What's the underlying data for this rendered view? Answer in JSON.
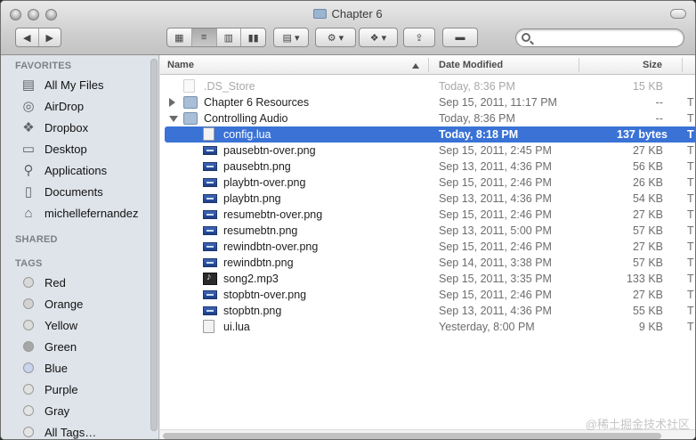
{
  "window": {
    "title": "Chapter 6"
  },
  "toolbar": {
    "view_icon": "icon-view-grid",
    "list_icon": "list-view-icon",
    "column_icon": "column-view-icon",
    "coverflow_icon": "coverflow-icon"
  },
  "sidebar": {
    "favorites_header": "FAVORITES",
    "favorites": [
      {
        "label": "All My Files",
        "icon": "all-files-icon"
      },
      {
        "label": "AirDrop",
        "icon": "airdrop-icon"
      },
      {
        "label": "Dropbox",
        "icon": "dropbox-icon"
      },
      {
        "label": "Desktop",
        "icon": "desktop-icon"
      },
      {
        "label": "Applications",
        "icon": "applications-icon"
      },
      {
        "label": "Documents",
        "icon": "documents-icon"
      },
      {
        "label": "michellefernandez",
        "icon": "home-icon"
      }
    ],
    "shared_header": "SHARED",
    "tags_header": "TAGS",
    "tags": [
      {
        "label": "Red",
        "color": "#d9d9d9"
      },
      {
        "label": "Orange",
        "color": "#d2d2d2"
      },
      {
        "label": "Yellow",
        "color": "#dcdcdc"
      },
      {
        "label": "Green",
        "color": "#a6a6a6"
      },
      {
        "label": "Blue",
        "color": "#c9d4ee"
      },
      {
        "label": "Purple",
        "color": "#e2e2e2"
      },
      {
        "label": "Gray",
        "color": "#e5e5e5"
      },
      {
        "label": "All Tags…",
        "color": "#e5e5e5"
      }
    ]
  },
  "list": {
    "columns": {
      "name": "Name",
      "date": "Date Modified",
      "size": "Size"
    },
    "rows": [
      {
        "name": ".DS_Store",
        "date": "Today, 8:36 PM",
        "size": "15 KB",
        "kind": "",
        "icon": "doc",
        "indent": 1,
        "disclosure": "none",
        "dim": true,
        "selected": false
      },
      {
        "name": "Chapter 6 Resources",
        "date": "Sep 15, 2011, 11:17 PM",
        "size": "--",
        "kind": "",
        "icon": "folder",
        "indent": 1,
        "disclosure": "closed",
        "dim": false,
        "selected": false
      },
      {
        "name": "Controlling Audio",
        "date": "Today, 8:36 PM",
        "size": "--",
        "kind": "",
        "icon": "folder",
        "indent": 1,
        "disclosure": "open",
        "dim": false,
        "selected": false
      },
      {
        "name": "config.lua",
        "date": "Today, 8:18 PM",
        "size": "137 bytes",
        "kind": "T",
        "icon": "doc",
        "indent": 2,
        "disclosure": "none",
        "dim": false,
        "selected": true
      },
      {
        "name": "pausebtn-over.png",
        "date": "Sep 15, 2011, 2:45 PM",
        "size": "27 KB",
        "kind": "",
        "icon": "png",
        "indent": 2,
        "disclosure": "none",
        "dim": false,
        "selected": false
      },
      {
        "name": "pausebtn.png",
        "date": "Sep 13, 2011, 4:36 PM",
        "size": "56 KB",
        "kind": "",
        "icon": "png",
        "indent": 2,
        "disclosure": "none",
        "dim": false,
        "selected": false
      },
      {
        "name": "playbtn-over.png",
        "date": "Sep 15, 2011, 2:46 PM",
        "size": "26 KB",
        "kind": "",
        "icon": "png",
        "indent": 2,
        "disclosure": "none",
        "dim": false,
        "selected": false
      },
      {
        "name": "playbtn.png",
        "date": "Sep 13, 2011, 4:36 PM",
        "size": "54 KB",
        "kind": "",
        "icon": "png",
        "indent": 2,
        "disclosure": "none",
        "dim": false,
        "selected": false
      },
      {
        "name": "resumebtn-over.png",
        "date": "Sep 15, 2011, 2:46 PM",
        "size": "27 KB",
        "kind": "",
        "icon": "png",
        "indent": 2,
        "disclosure": "none",
        "dim": false,
        "selected": false
      },
      {
        "name": "resumebtn.png",
        "date": "Sep 13, 2011, 5:00 PM",
        "size": "57 KB",
        "kind": "",
        "icon": "png",
        "indent": 2,
        "disclosure": "none",
        "dim": false,
        "selected": false
      },
      {
        "name": "rewindbtn-over.png",
        "date": "Sep 15, 2011, 2:46 PM",
        "size": "27 KB",
        "kind": "",
        "icon": "png",
        "indent": 2,
        "disclosure": "none",
        "dim": false,
        "selected": false
      },
      {
        "name": "rewindbtn.png",
        "date": "Sep 14, 2011, 3:38 PM",
        "size": "57 KB",
        "kind": "",
        "icon": "png",
        "indent": 2,
        "disclosure": "none",
        "dim": false,
        "selected": false
      },
      {
        "name": "song2.mp3",
        "date": "Sep 15, 2011, 3:35 PM",
        "size": "133 KB",
        "kind": "",
        "icon": "mp3",
        "indent": 2,
        "disclosure": "none",
        "dim": false,
        "selected": false
      },
      {
        "name": "stopbtn-over.png",
        "date": "Sep 15, 2011, 2:46 PM",
        "size": "27 KB",
        "kind": "",
        "icon": "png",
        "indent": 2,
        "disclosure": "none",
        "dim": false,
        "selected": false
      },
      {
        "name": "stopbtn.png",
        "date": "Sep 13, 2011, 4:36 PM",
        "size": "55 KB",
        "kind": "",
        "icon": "png",
        "indent": 2,
        "disclosure": "none",
        "dim": false,
        "selected": false
      },
      {
        "name": "ui.lua",
        "date": "Yesterday, 8:00 PM",
        "size": "9 KB",
        "kind": "",
        "icon": "doc",
        "indent": 2,
        "disclosure": "none",
        "dim": false,
        "selected": false
      }
    ],
    "right_cut_kinds": [
      "T",
      "T",
      "T",
      "T",
      "T",
      "T",
      "T",
      "T",
      "T",
      "T",
      "T",
      "T",
      "T",
      "T",
      "T"
    ]
  },
  "watermark": "@稀土掘金技术社区"
}
